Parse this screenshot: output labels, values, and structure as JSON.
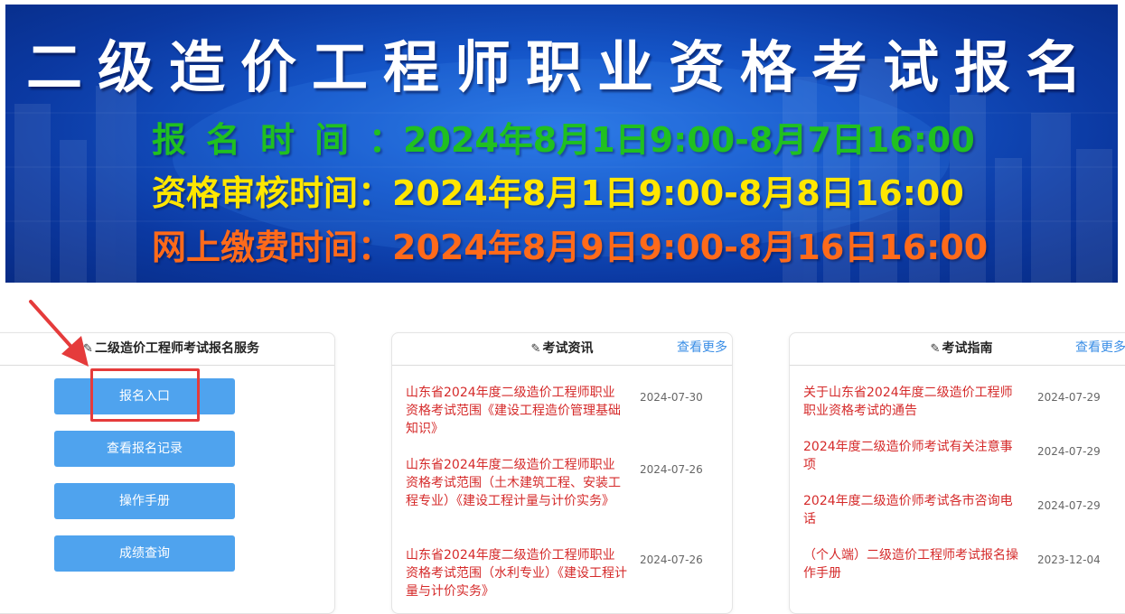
{
  "banner": {
    "title": "二级造价工程师职业资格考试报名",
    "lines": [
      {
        "label": "报名时间",
        "value": "：2024年8月1日9:00-8月7日16:00"
      },
      {
        "label": "资格审核时间",
        "value": "：2024年8月1日9:00-8月8日16:00"
      },
      {
        "label": "网上缴费时间",
        "value": "：2024年8月9日9:00-8月16日16:00"
      }
    ]
  },
  "service": {
    "title": "二级造价工程师考试报名服务",
    "buttons": [
      "报名入口",
      "查看报名记录",
      "操作手册",
      "成绩查询"
    ]
  },
  "news": {
    "title": "考试资讯",
    "more": "查看更多",
    "items": [
      {
        "text": "山东省2024年度二级造价工程师职业资格考试范围《建设工程造价管理基础知识》",
        "date": "2024-07-30"
      },
      {
        "text": "山东省2024年度二级造价工程师职业资格考试范围（土木建筑工程、安装工程专业）《建设工程计量与计价实务》",
        "date": "2024-07-26"
      },
      {
        "text": "山东省2024年度二级造价工程师职业资格考试范围（水利专业）《建设工程计量与计价实务》",
        "date": "2024-07-26"
      }
    ]
  },
  "guide": {
    "title": "考试指南",
    "more": "查看更多",
    "items": [
      {
        "text": "关于山东省2024年度二级造价工程师职业资格考试的通告",
        "date": "2024-07-29"
      },
      {
        "text": "2024年度二级造价师考试有关注意事项",
        "date": "2024-07-29"
      },
      {
        "text": "2024年度二级造价师考试各市咨询电话",
        "date": "2024-07-29"
      },
      {
        "text": "（个人端）二级造价工程师考试报名操作手册",
        "date": "2023-12-04"
      }
    ]
  },
  "colors": {
    "banner_bg": "#1556c9",
    "line1": "#20c020",
    "line2": "#ffe600",
    "line3": "#ff6a1a",
    "button": "#4fa3ee",
    "link_red": "#d52a2a",
    "more_blue": "#3a8ee6",
    "highlight": "#e53b3b"
  },
  "icons": [
    "pencil-icon",
    "arrow-annotation"
  ]
}
